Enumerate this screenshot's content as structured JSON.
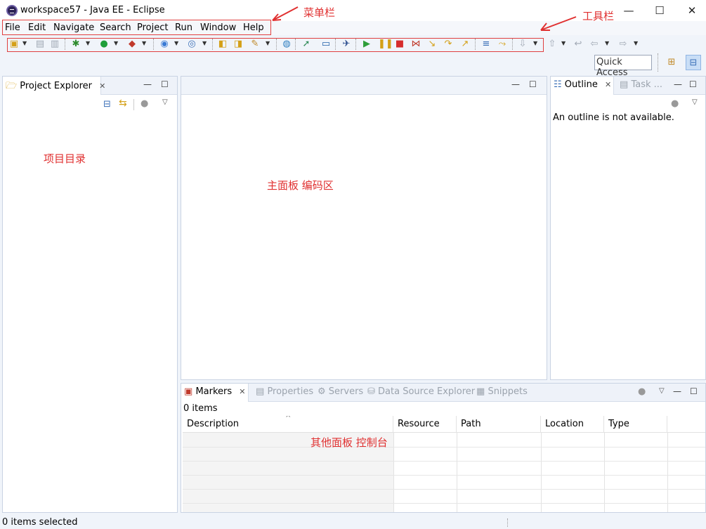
{
  "window": {
    "title": "workspace57 - Java EE - Eclipse",
    "minimize": "—",
    "maximize": "☐",
    "close": "✕"
  },
  "menu": {
    "items": [
      "File",
      "Edit",
      "Navigate",
      "Search",
      "Project",
      "Run",
      "Window",
      "Help"
    ]
  },
  "annotations": {
    "menubar": "菜单栏",
    "toolbar": "工具栏",
    "project_dir": "项目目录",
    "main_panel": "主面板   编码区",
    "other_panel": "其他面板   控制台"
  },
  "toolbar": {
    "quick_access": "Quick Access"
  },
  "project_explorer": {
    "tab": "Project Explorer"
  },
  "outline": {
    "tab": "Outline",
    "tab2": "Task ...",
    "message": "An outline is not available."
  },
  "bottom": {
    "tabs": [
      "Markers",
      "Properties",
      "Servers",
      "Data Source Explorer",
      "Snippets"
    ],
    "count": "0 items",
    "columns": [
      "Description",
      "Resource",
      "Path",
      "Location",
      "Type"
    ]
  },
  "status": {
    "text": "0 items selected"
  },
  "colors": {
    "annotation": "#e03030",
    "accent": "#3a6fb7"
  }
}
